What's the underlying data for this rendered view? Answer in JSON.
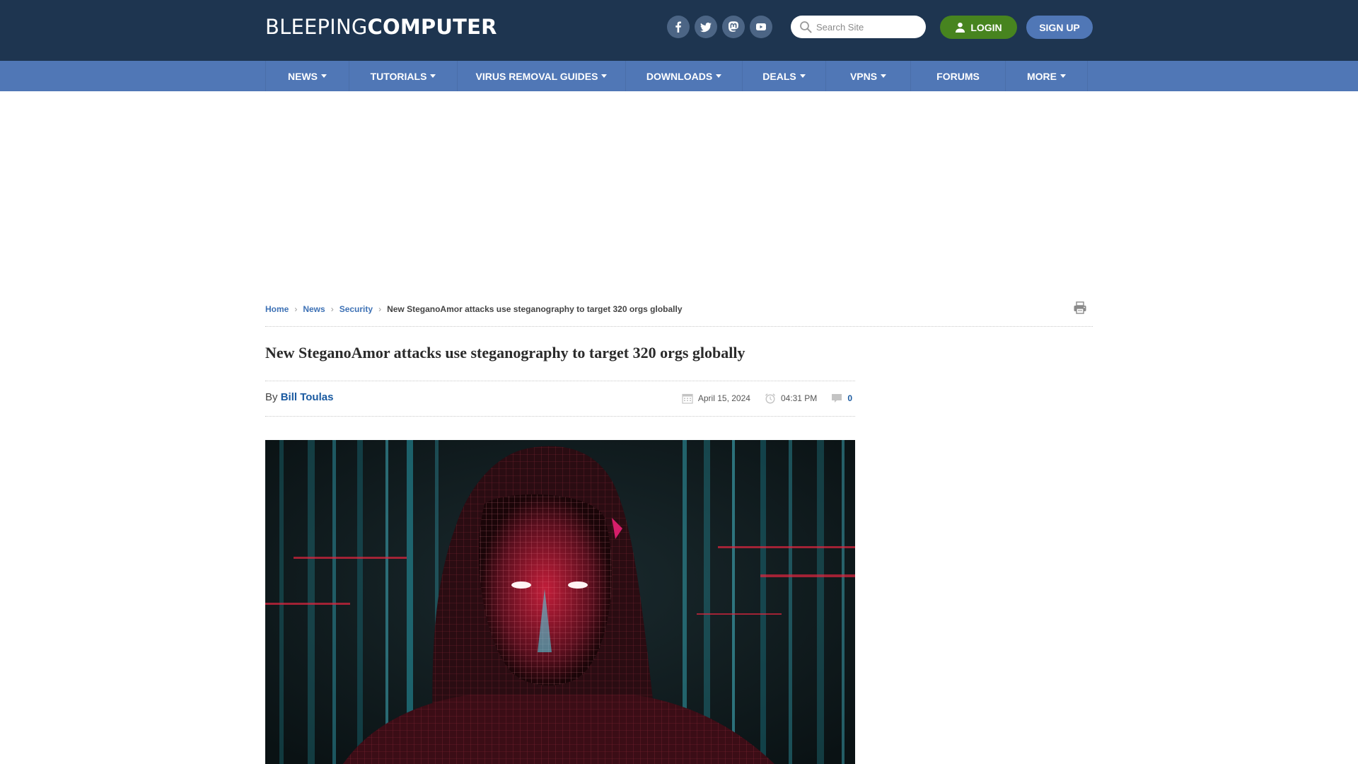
{
  "header": {
    "logo": {
      "thin": "BLEEPING",
      "bold": "COMPUTER"
    },
    "social": [
      {
        "name": "facebook",
        "icon": "facebook-icon"
      },
      {
        "name": "twitter",
        "icon": "twitter-icon"
      },
      {
        "name": "mastodon",
        "icon": "mastodon-icon"
      },
      {
        "name": "youtube",
        "icon": "youtube-icon"
      }
    ],
    "search": {
      "placeholder": "Search Site",
      "value": ""
    },
    "login_label": "LOGIN",
    "signup_label": "SIGN UP"
  },
  "nav": {
    "items": [
      {
        "label": "NEWS",
        "dropdown": true
      },
      {
        "label": "TUTORIALS",
        "dropdown": true
      },
      {
        "label": "VIRUS REMOVAL GUIDES",
        "dropdown": true
      },
      {
        "label": "DOWNLOADS",
        "dropdown": true
      },
      {
        "label": "DEALS",
        "dropdown": true
      },
      {
        "label": "VPNS",
        "dropdown": true
      },
      {
        "label": "FORUMS",
        "dropdown": false
      },
      {
        "label": "MORE",
        "dropdown": true
      }
    ]
  },
  "breadcrumb": {
    "items": [
      "Home",
      "News",
      "Security"
    ],
    "current": "New SteganoAmor attacks use steganography to target 320 orgs globally"
  },
  "article": {
    "title": "New SteganoAmor attacks use steganography to target 320 orgs globally",
    "by_label": "By",
    "author": "Bill Toulas",
    "date": "April 15, 2024",
    "time": "04:31 PM",
    "comments": "0",
    "hero_alt": "Hooded figure with wireframe face and glowing eyes over cyan digital code background"
  },
  "colors": {
    "header_bg": "#1e3550",
    "nav_bg": "#5077b6",
    "login_green": "#47841f",
    "link_blue": "#1a5aa0"
  }
}
